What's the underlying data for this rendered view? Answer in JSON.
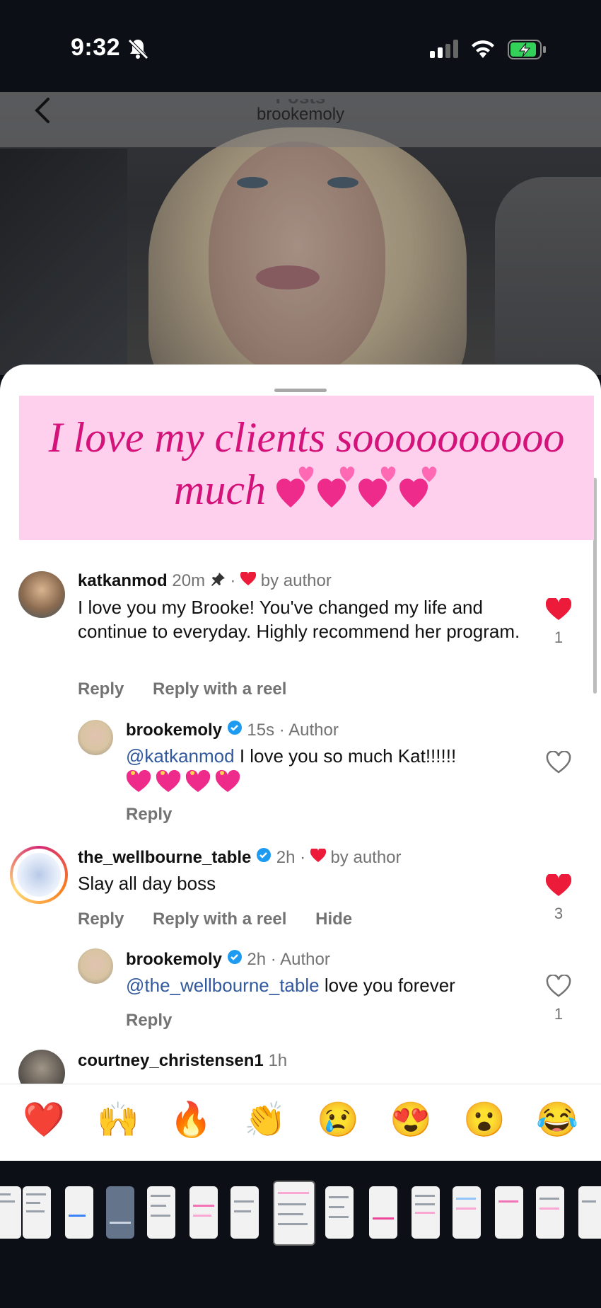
{
  "status_bar": {
    "time": "9:32"
  },
  "header": {
    "title": "Posts",
    "username": "brookemoly"
  },
  "banner": {
    "line1": "I love my clients soooooooooo",
    "line2": "much"
  },
  "comments": [
    {
      "username": "katkanmod",
      "time": "20m",
      "by_author": "by author",
      "text": "I love you my Brooke! You've changed my life and continue to everyday. Highly recommend her program.",
      "reply_label": "Reply",
      "reply_reel_label": "Reply with a reel",
      "likes": "1"
    },
    {
      "username": "brookemoly",
      "time": "15s",
      "author_label": "Author",
      "mention": "@katkanmod",
      "text": "I love you so much Kat!!!!!!",
      "reply_label": "Reply"
    },
    {
      "username": "the_wellbourne_table",
      "time": "2h",
      "by_author": "by author",
      "text": "Slay all day boss",
      "reply_label": "Reply",
      "reply_reel_label": "Reply with a reel",
      "hide_label": "Hide",
      "likes": "3"
    },
    {
      "username": "brookemoly",
      "time": "2h",
      "author_label": "Author",
      "mention": "@the_wellbourne_table",
      "text": "love you forever",
      "reply_label": "Reply",
      "likes": "1"
    },
    {
      "username": "courtney_christensen1",
      "time": "1h"
    }
  ],
  "reactions": [
    "❤️",
    "🙌",
    "🔥",
    "👏",
    "😢",
    "😍",
    "😮",
    "😂"
  ],
  "colors": {
    "accent_pink": "#d4137a",
    "banner_bg": "#ffcfee",
    "like_red": "#ed1b3a",
    "mention_blue": "#32599d",
    "verified_blue": "#1d9bf0"
  }
}
